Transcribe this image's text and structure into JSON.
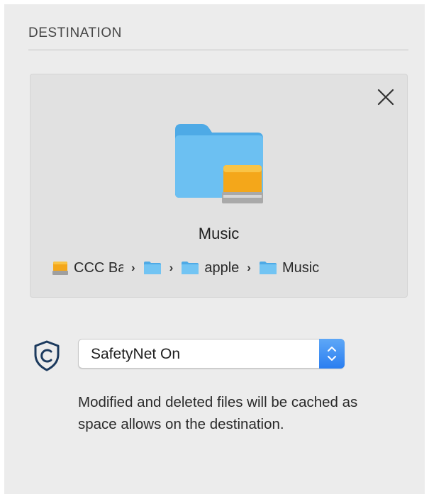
{
  "section": {
    "header": "DESTINATION"
  },
  "destination": {
    "name": "Music",
    "icon": "folder-with-drive-icon",
    "path": [
      {
        "icon": "drive-icon",
        "label": "CCC Backup"
      },
      {
        "icon": "folder-icon",
        "label": ""
      },
      {
        "icon": "folder-icon",
        "label": "apple"
      },
      {
        "icon": "folder-icon",
        "label": "Music"
      }
    ]
  },
  "safetynet": {
    "icon": "shield-c-icon",
    "selected": "SafetyNet On",
    "description": "Modified and deleted files will be cached as space allows on the destination."
  },
  "colors": {
    "folder": "#5bb6ee",
    "drive": "#f2a51b",
    "accent": "#2a7ef0",
    "shield": "#1c3a5e"
  }
}
